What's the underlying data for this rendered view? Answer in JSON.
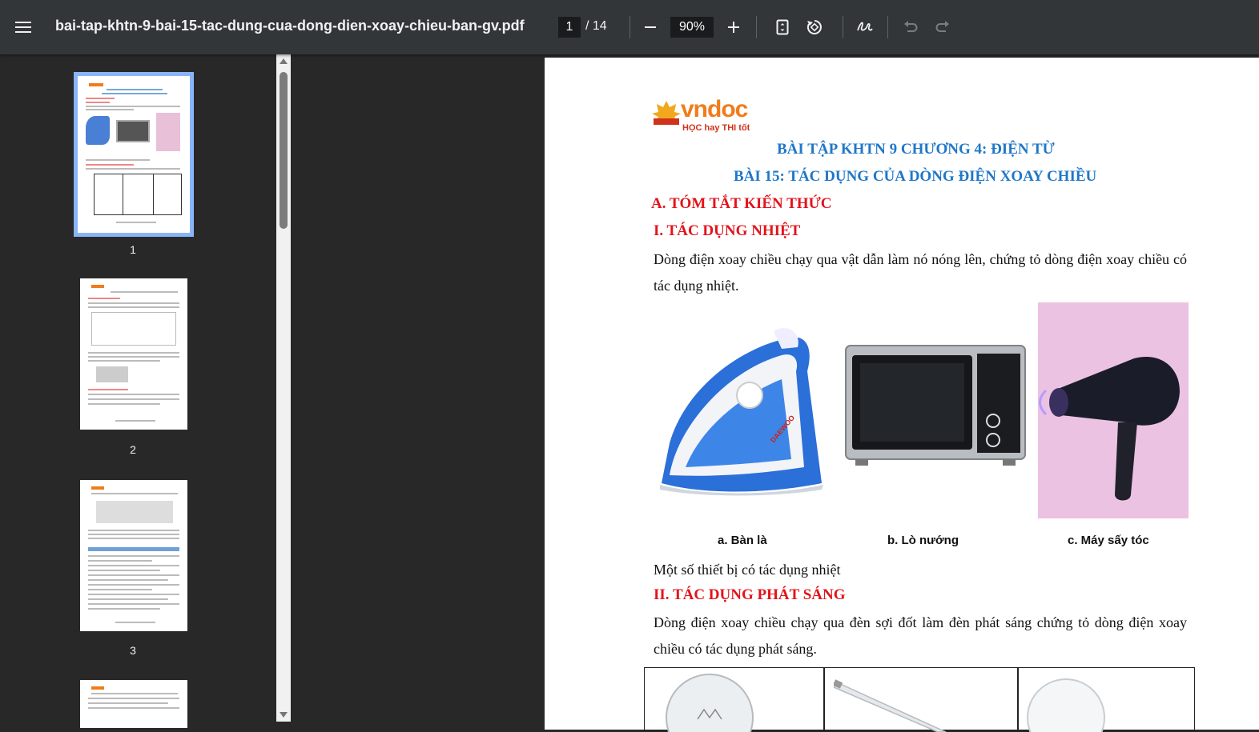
{
  "toolbar": {
    "title": "bai-tap-khtn-9-bai-15-tac-dung-cua-dong-dien-xoay-chieu-ban-gv.pdf",
    "current_page": "1",
    "total_pages": "/ 14",
    "zoom": "90%",
    "icons": [
      "menu-icon",
      "zoom-out-icon",
      "zoom-in-icon",
      "fit-page-icon",
      "rotate-icon",
      "annotate-icon",
      "undo-icon",
      "redo-icon"
    ]
  },
  "sidebar": {
    "thumbnails": [
      {
        "label": "1"
      },
      {
        "label": "2"
      },
      {
        "label": "3"
      }
    ]
  },
  "document": {
    "logo_text": "vndoc",
    "logo_tagline": "HỌC hay THI tốt",
    "heading1": "BÀI TẬP KHTN 9 CHƯƠNG 4: ĐIỆN TỪ",
    "heading2": "BÀI 15: TÁC DỤNG CỦA DÒNG ĐIỆN XOAY CHIỀU",
    "section_a": "A. TÓM TẮT KIẾN THỨC",
    "section_1": "I. TÁC DỤNG NHIỆT",
    "para1": "Dòng điện xoay chiều chạy qua vật dẫn làm nó nóng lên, chứng tỏ dòng điện xoay chiều có tác dụng nhiệt.",
    "captions": [
      "a. Bàn là",
      "b. Lò nướng",
      "c. Máy sấy tóc"
    ],
    "iron_brand": "DAEWOO",
    "figure_note": "Một số thiết bị có tác dụng nhiệt",
    "section_2": "II. TÁC DỤNG PHÁT SÁNG",
    "para2": "Dòng điện xoay chiều chạy qua đèn sợi đốt làm đèn phát sáng chứng tỏ dòng điện xoay chiều có tác dụng phát sáng."
  },
  "colors": {
    "toolbar_bg": "#323639",
    "viewer_bg": "#282828",
    "heading_blue": "#1f77c9",
    "heading_red": "#e3131a",
    "thumb_selected": "#8ab4f8"
  }
}
